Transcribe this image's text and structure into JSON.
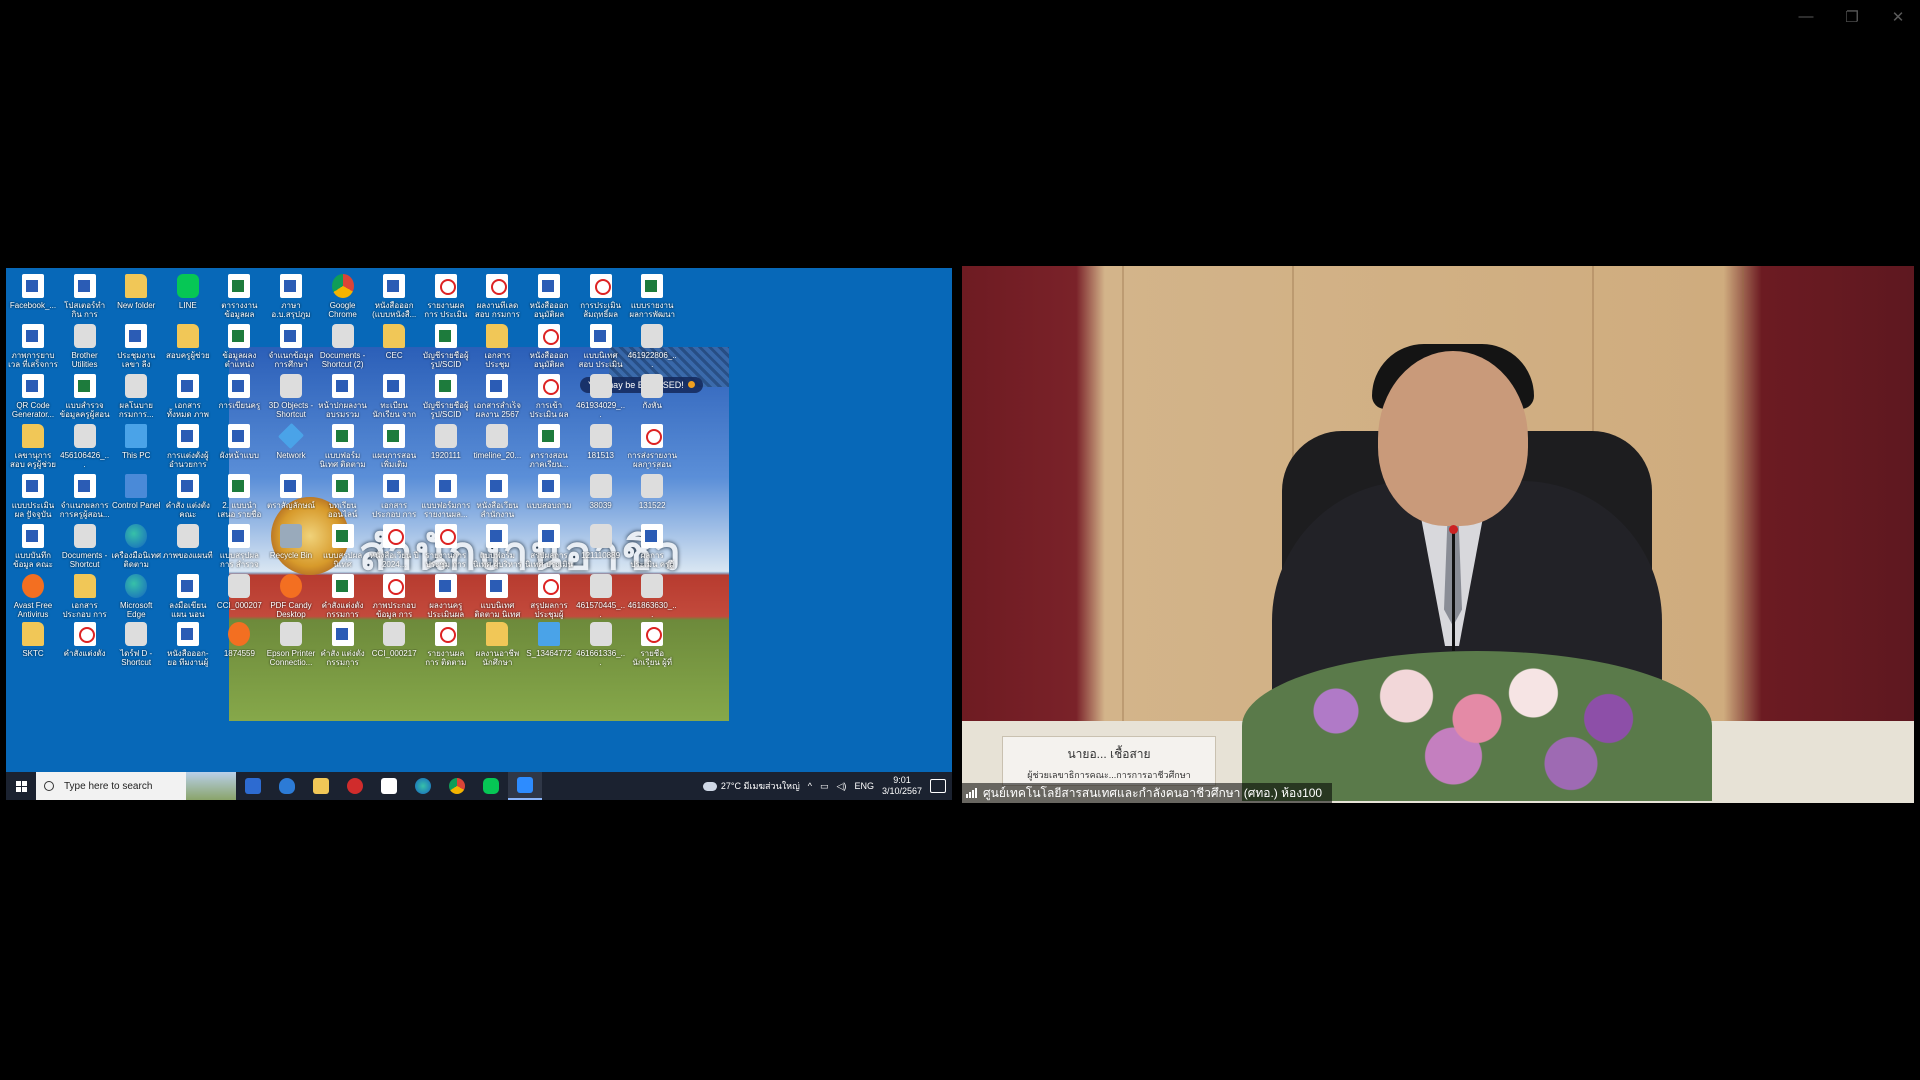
{
  "window": {
    "controls": [
      "minimize",
      "restore",
      "close"
    ]
  },
  "desktop": {
    "popup": "You may be EXPOSED!",
    "icons": [
      {
        "label": "Facebook_...",
        "type": "doc"
      },
      {
        "label": "โปสเตอร์ทำกิน การประเมิน...",
        "type": "doc"
      },
      {
        "label": "New folder",
        "type": "folder"
      },
      {
        "label": "LINE",
        "type": "line"
      },
      {
        "label": "ตารางงาน ข้อมูลผลการ...",
        "type": "xls"
      },
      {
        "label": "ภาษา อ.บ.สรุปภูม",
        "type": "doc"
      },
      {
        "label": "Google Chrome",
        "type": "chrome"
      },
      {
        "label": "หนังสือออก (แบบหนังสื...",
        "type": "doc"
      },
      {
        "label": "รายงานผลการ ประเมินผลการ...",
        "type": "pdf"
      },
      {
        "label": "ผลงานทีเลดสอบ กรมการบาศึก...",
        "type": "pdf"
      },
      {
        "label": "หนังสือออก อนุมัติผลอ้างอิง...",
        "type": "doc"
      },
      {
        "label": "การประเมิน ส้มฤทธิ์ผลการ...",
        "type": "pdf"
      },
      {
        "label": "แบบรายงาน ผลการพัฒนาตน...",
        "type": "xls"
      },
      {
        "label": "ภาพการยาบเวล ที่เสร็จการสกรีน...",
        "type": "doc"
      },
      {
        "label": "Brother Utilities",
        "type": "app"
      },
      {
        "label": "ประชุมงานเลขา ลีง",
        "type": "doc"
      },
      {
        "label": "สอบครูผู้ช่วย",
        "type": "folder"
      },
      {
        "label": "ข้อมูลผลง ตำแหน่งพนัก...",
        "type": "xls"
      },
      {
        "label": "จำแนกข้อมูล การศึกษาอาชีพ...",
        "type": "doc"
      },
      {
        "label": "Documents - Shortcut (2)",
        "type": "app"
      },
      {
        "label": "CEC",
        "type": "folder"
      },
      {
        "label": "บัญชีรายชื่อผู้ รูป/SCID 2024...",
        "type": "xls"
      },
      {
        "label": "เอกสารประชุม กรรมการ...",
        "type": "folder"
      },
      {
        "label": "หนังสือออก อนุมัติผลอ้างอิง...",
        "type": "pdf"
      },
      {
        "label": "แบบนิเทศ สอบ ประเมินสำหรับ...",
        "type": "doc"
      },
      {
        "label": "461922806_...",
        "type": "app"
      },
      {
        "label": "QR Code Generator...",
        "type": "doc"
      },
      {
        "label": "แบบสำรวจ ข้อมูลครูผู้สอน",
        "type": "xls"
      },
      {
        "label": "ผลโนบาย กรมการ...",
        "type": "app"
      },
      {
        "label": "เอกสารทั้งหมด ภาพ",
        "type": "doc"
      },
      {
        "label": "การเขียนครู",
        "type": "doc"
      },
      {
        "label": "3D Objects - Shortcut",
        "type": "app"
      },
      {
        "label": "หน้าปกผลงาน อบรมรวม 2566",
        "type": "doc"
      },
      {
        "label": "ทะเบียนนักเรียน จากระบบ",
        "type": "doc"
      },
      {
        "label": "บัญชีรายชื่อผู้ รูป/SCID 2024...",
        "type": "xls"
      },
      {
        "label": "เอกสารสำเร็จ ผลงาน 2567",
        "type": "doc"
      },
      {
        "label": "การเข้าประเมิน ผลงานทีเลดสอบ...",
        "type": "pdf"
      },
      {
        "label": "461934029_...",
        "type": "app"
      },
      {
        "label": "กังหัน",
        "type": "app"
      },
      {
        "label": "เลขานุการ สอบ ครูผู้ช่วย",
        "type": "folder"
      },
      {
        "label": "456106426_...",
        "type": "app"
      },
      {
        "label": "This PC",
        "type": "pc"
      },
      {
        "label": "การแต่งตั้งผู้ อำนวยการ ค...",
        "type": "doc"
      },
      {
        "label": "ผังหน้าแบบ",
        "type": "doc"
      },
      {
        "label": "Network",
        "type": "net"
      },
      {
        "label": "แบบฟอร์มนิเทศ ติดตามผลการ...",
        "type": "xls"
      },
      {
        "label": "แผนการสอน เพิ่มเติมสาระ...",
        "type": "xls"
      },
      {
        "label": "1920111",
        "type": "app"
      },
      {
        "label": "timeline_20...",
        "type": "app"
      },
      {
        "label": "ตารางสอน ภาคเรียน...",
        "type": "xls"
      },
      {
        "label": "181513",
        "type": "app"
      },
      {
        "label": "การส่งรายงาน ผลการสอน ครั้งที่...",
        "type": "pdf"
      },
      {
        "label": "แบบประเมินผล ปัจจุบัน ครั้งที่...",
        "type": "doc"
      },
      {
        "label": "จำแนกผลการ การครูผู้สอน...",
        "type": "doc"
      },
      {
        "label": "Control Panel",
        "type": "cp"
      },
      {
        "label": "คำสั่ง แต่งตั้ง คณะกรรมการ...",
        "type": "doc"
      },
      {
        "label": "2. แบบนำเสนอ รายชื่อนักเรียน...",
        "type": "xls"
      },
      {
        "label": "ตราสัญลักษณ์",
        "type": "doc"
      },
      {
        "label": "บทเรียนออนไลน์",
        "type": "xls"
      },
      {
        "label": "เอกสารประกอบ การประชุม",
        "type": "doc"
      },
      {
        "label": "แบบฟอร์มการ รายงานผล...",
        "type": "doc"
      },
      {
        "label": "หนังสือเวียน สำนักงาน 2567",
        "type": "doc"
      },
      {
        "label": "แบบสอบถาม",
        "type": "doc"
      },
      {
        "label": "38039",
        "type": "app"
      },
      {
        "label": "131522",
        "type": "app"
      },
      {
        "label": "แบบบันทึกข้อมูล คณะกรรมการ",
        "type": "doc"
      },
      {
        "label": "Documents - Shortcut",
        "type": "app"
      },
      {
        "label": "เครื่องมือนิเทศ ติดตาม Cam...",
        "type": "edge"
      },
      {
        "label": "ภาพของแผนที่",
        "type": "app"
      },
      {
        "label": "แบบสรุปผลการ สำรวจ",
        "type": "doc"
      },
      {
        "label": "Recycle Bin",
        "type": "bin"
      },
      {
        "label": "แบบสรุปผล นิเทศ",
        "type": "xls"
      },
      {
        "label": "หนังสือเวียน ปี 2024...",
        "type": "pdf"
      },
      {
        "label": "รายงานการประชุม การขับเคลื่อน...",
        "type": "pdf"
      },
      {
        "label": "แบบฟอร์มนิเทศ ผู้บริหารสถาน...",
        "type": "doc"
      },
      {
        "label": "สรุปผลการนิเทศ ประเมินผลการ...",
        "type": "doc"
      },
      {
        "label": "121110889",
        "type": "app"
      },
      {
        "label": "ผลการประเมิน ครูผู้สอนรายวิชา...",
        "type": "doc"
      },
      {
        "label": "Avast Free Antivirus",
        "type": "avast"
      },
      {
        "label": "เอกสารประกอบ การพัฒนาครูผู้...",
        "type": "folder"
      },
      {
        "label": "Microsoft Edge",
        "type": "edge"
      },
      {
        "label": "ลงมือเขียนแผน นอน",
        "type": "doc"
      },
      {
        "label": "CCI_000207",
        "type": "app"
      },
      {
        "label": "PDF Candy Desktop",
        "type": "avast"
      },
      {
        "label": "คำสั่งแต่งตั้ง กรรมการทำงาน...",
        "type": "xls"
      },
      {
        "label": "ภาพประกอบข้อมูล การพัฒนาบุคลากร...",
        "type": "pdf"
      },
      {
        "label": "ผลงานครู ประเมินผล 2567",
        "type": "doc"
      },
      {
        "label": "แบบนิเทศ ติดตาม นิเทศ",
        "type": "doc"
      },
      {
        "label": "สรุปผลการ ประชุมผู้ปกครอง...",
        "type": "pdf"
      },
      {
        "label": "461570445_...",
        "type": "app"
      },
      {
        "label": "461863630_...",
        "type": "app"
      },
      {
        "label": "SKTC",
        "type": "folder"
      },
      {
        "label": "คำสั่งแต่งตั้ง",
        "type": "pdf"
      },
      {
        "label": "ไดร์ฟ D - Shortcut",
        "type": "app"
      },
      {
        "label": "หนังสือออก-ยอ ทีมงานผู้บริหาร...",
        "type": "doc"
      },
      {
        "label": "1874559",
        "type": "avast"
      },
      {
        "label": "Epson Printer Connectio...",
        "type": "app"
      },
      {
        "label": "คำสั่ง แต่งตั้ง กรรมการ หน้าที่...",
        "type": "doc"
      },
      {
        "label": "CCI_000217",
        "type": "app"
      },
      {
        "label": "รายงานผลการ ติดตาม กรณ...",
        "type": "pdf"
      },
      {
        "label": "ผลงานอาชีพ นักศึกษา",
        "type": "folder"
      },
      {
        "label": "S_13464772",
        "type": "pc"
      },
      {
        "label": "461661336_...",
        "type": "app"
      },
      {
        "label": "รายชื่อนักเรียน ผู้ที่ สำเร็จการศึก...",
        "type": "pdf"
      }
    ]
  },
  "taskbar": {
    "search_placeholder": "Type here to search",
    "weather": "27°C มีเมฆส่วนใหญ่",
    "language": "ENG",
    "time": "9:01",
    "date": "3/10/2567"
  },
  "video": {
    "nameplate_name": "นายอ...  เชื้อสาย",
    "nameplate_title": "ผู้ช่วยเลขาธิการคณะ...การการอาชีวศึกษา",
    "participant_name": "ศูนย์เทคโนโลยีสารสนเทศและกำลังคนอาชีวศึกษา (ศทอ.) ห้อง100"
  }
}
